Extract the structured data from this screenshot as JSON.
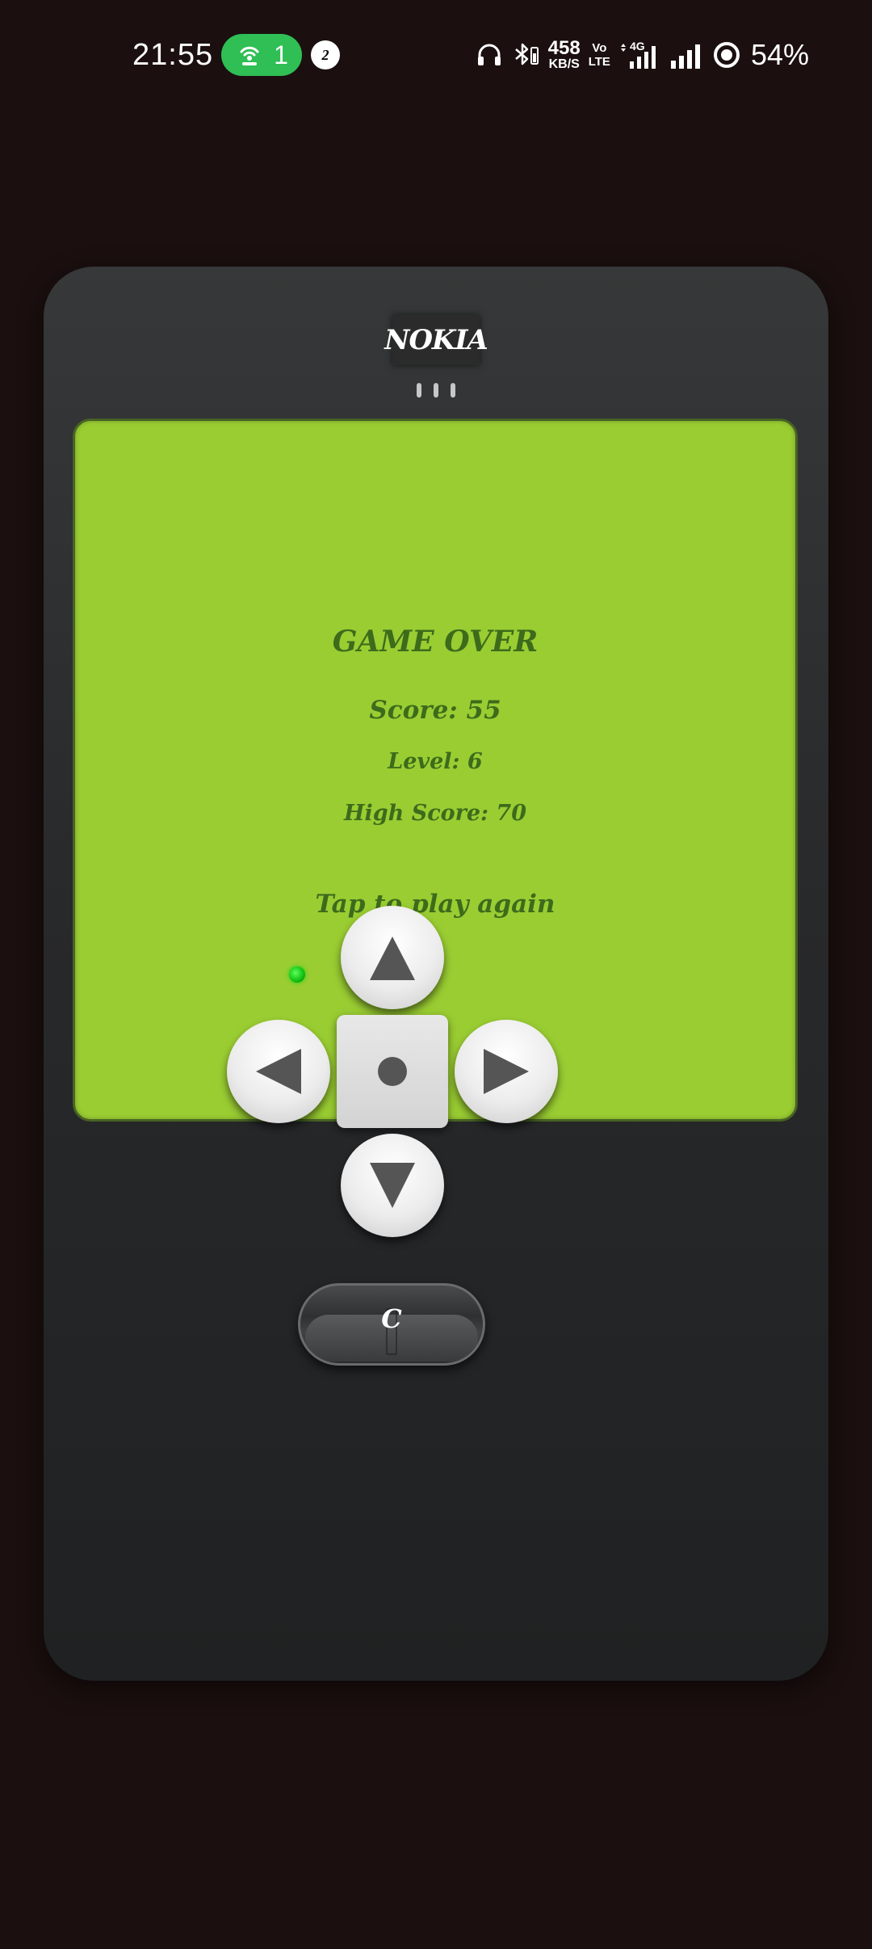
{
  "status_bar": {
    "time": "21:55",
    "hotspot_icon": "hotspot-icon",
    "hotspot_count": "1",
    "notification_count": "2",
    "icons": [
      "headphones-icon",
      "bluetooth-icon",
      "vibrate-battery-icon",
      "signal-4g-icon",
      "signal-icon",
      "battery-saver-icon"
    ],
    "net_speed_value": "458",
    "net_speed_unit": "KB/S",
    "volte_top": "Vo",
    "volte_bottom": "LTE",
    "network_type": "4G",
    "battery": "54%",
    "hotspot_color": "#2fbf55"
  },
  "device": {
    "brand": "NOKIA",
    "body_color": "#2b2c2e"
  },
  "game_screen": {
    "background_color": "#9acd32",
    "text_color": "#3d6b1c",
    "title": "GAME OVER",
    "score": "Score: 55",
    "level": "Level: 6",
    "high_score": "High Score: 70",
    "prompt": "Tap to play again"
  },
  "controls": {
    "led_color": "#18d418",
    "up_icon": "up-arrow-icon",
    "down_icon": "down-arrow-icon",
    "left_icon": "left-arrow-icon",
    "right_icon": "right-arrow-icon",
    "center_icon": "center-dot-icon",
    "clear_label": "C"
  }
}
